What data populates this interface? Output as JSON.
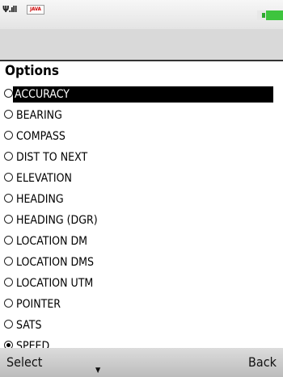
{
  "status": {
    "signal_icon": "signal-icon",
    "java_badge": "JAVA",
    "battery_icon": "battery-icon"
  },
  "title": "Options",
  "items": [
    {
      "label": "ACCURACY",
      "selected": true,
      "checked": false
    },
    {
      "label": "BEARING",
      "selected": false,
      "checked": false
    },
    {
      "label": "COMPASS",
      "selected": false,
      "checked": false
    },
    {
      "label": "DIST TO NEXT",
      "selected": false,
      "checked": false
    },
    {
      "label": "ELEVATION",
      "selected": false,
      "checked": false
    },
    {
      "label": "HEADING",
      "selected": false,
      "checked": false
    },
    {
      "label": "HEADING (DGR)",
      "selected": false,
      "checked": false
    },
    {
      "label": "LOCATION DM",
      "selected": false,
      "checked": false
    },
    {
      "label": "LOCATION DMS",
      "selected": false,
      "checked": false
    },
    {
      "label": "LOCATION UTM",
      "selected": false,
      "checked": false
    },
    {
      "label": "POINTER",
      "selected": false,
      "checked": false
    },
    {
      "label": "SATS",
      "selected": false,
      "checked": false
    },
    {
      "label": "SPEED",
      "selected": false,
      "checked": true
    }
  ],
  "softkeys": {
    "left": "Select",
    "right": "Back",
    "scroll_icon": "down-arrow-icon"
  }
}
